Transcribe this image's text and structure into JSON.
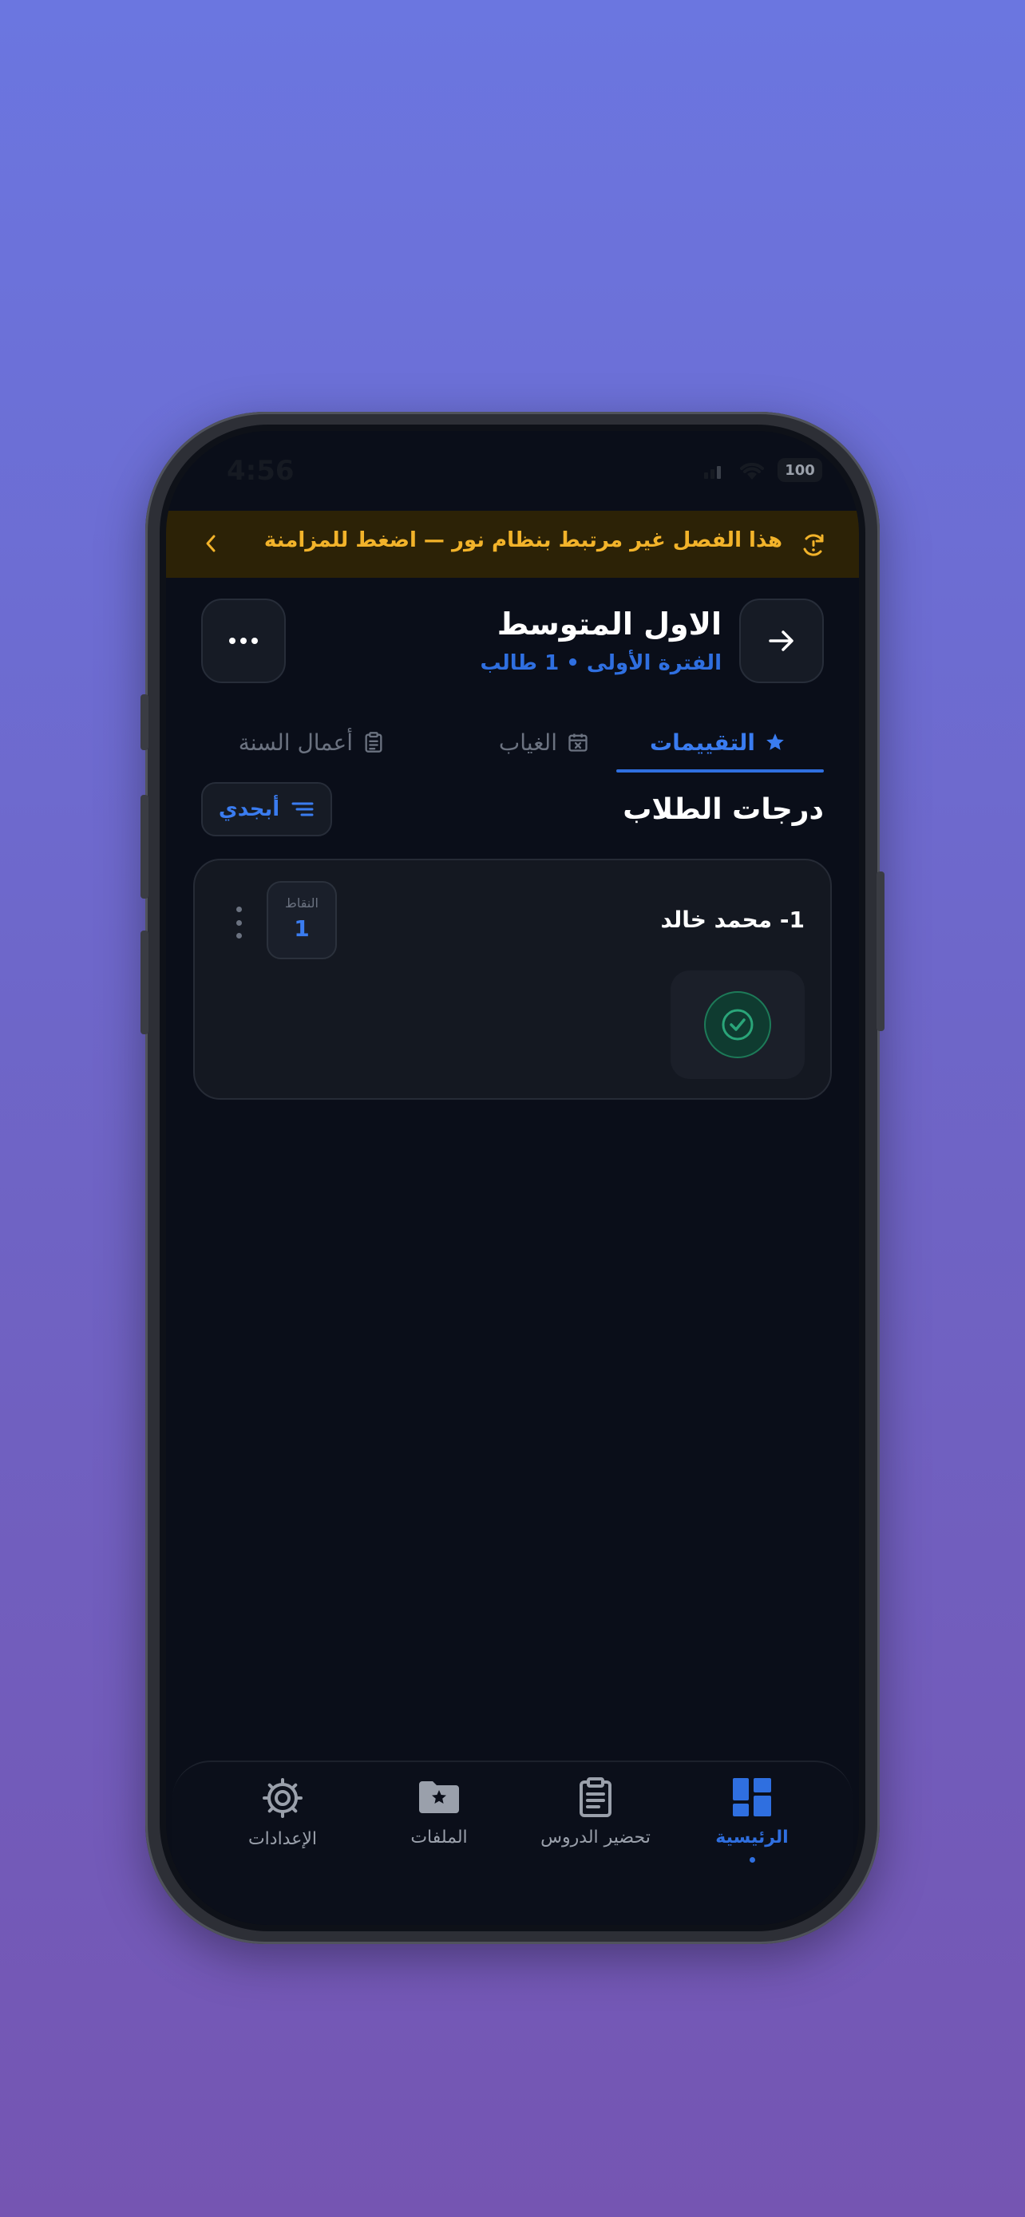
{
  "status_bar": {
    "time": "4:56",
    "battery": "100"
  },
  "sync_banner": {
    "text": "هذا الفصل غير مرتبط بنظام نور — اضغط للمزامنة"
  },
  "header": {
    "title": "الاول المتوسط",
    "subtitle": "الفترة الأولى • 1 طالب"
  },
  "tabs": [
    {
      "label": "التقييمات",
      "icon": "star-icon",
      "active": true
    },
    {
      "label": "الغياب",
      "icon": "calendar-x-icon",
      "active": false
    },
    {
      "label": "أعمال السنة",
      "icon": "clipboard-icon",
      "active": false
    }
  ],
  "section": {
    "title": "درجات الطلاب",
    "sort_label": "أبجدي"
  },
  "students": [
    {
      "name": "1- محمد خالد",
      "points_label": "النقاط",
      "points": "1",
      "status": "check-circle-icon"
    }
  ],
  "bottom_nav": [
    {
      "label": "الرئيسية",
      "icon": "dashboard-icon",
      "active": true
    },
    {
      "label": "تحضير الدروس",
      "icon": "clipboard-list-icon",
      "active": false
    },
    {
      "label": "الملفات",
      "icon": "folder-star-icon",
      "active": false
    },
    {
      "label": "الإعدادات",
      "icon": "gear-icon",
      "active": false
    }
  ],
  "colors": {
    "accent": "#2f6fe0",
    "banner_text": "#f2b32a",
    "banner_bg": "#2c2206",
    "success": "#1d7a58",
    "screen_bg": "#0a0e19"
  }
}
